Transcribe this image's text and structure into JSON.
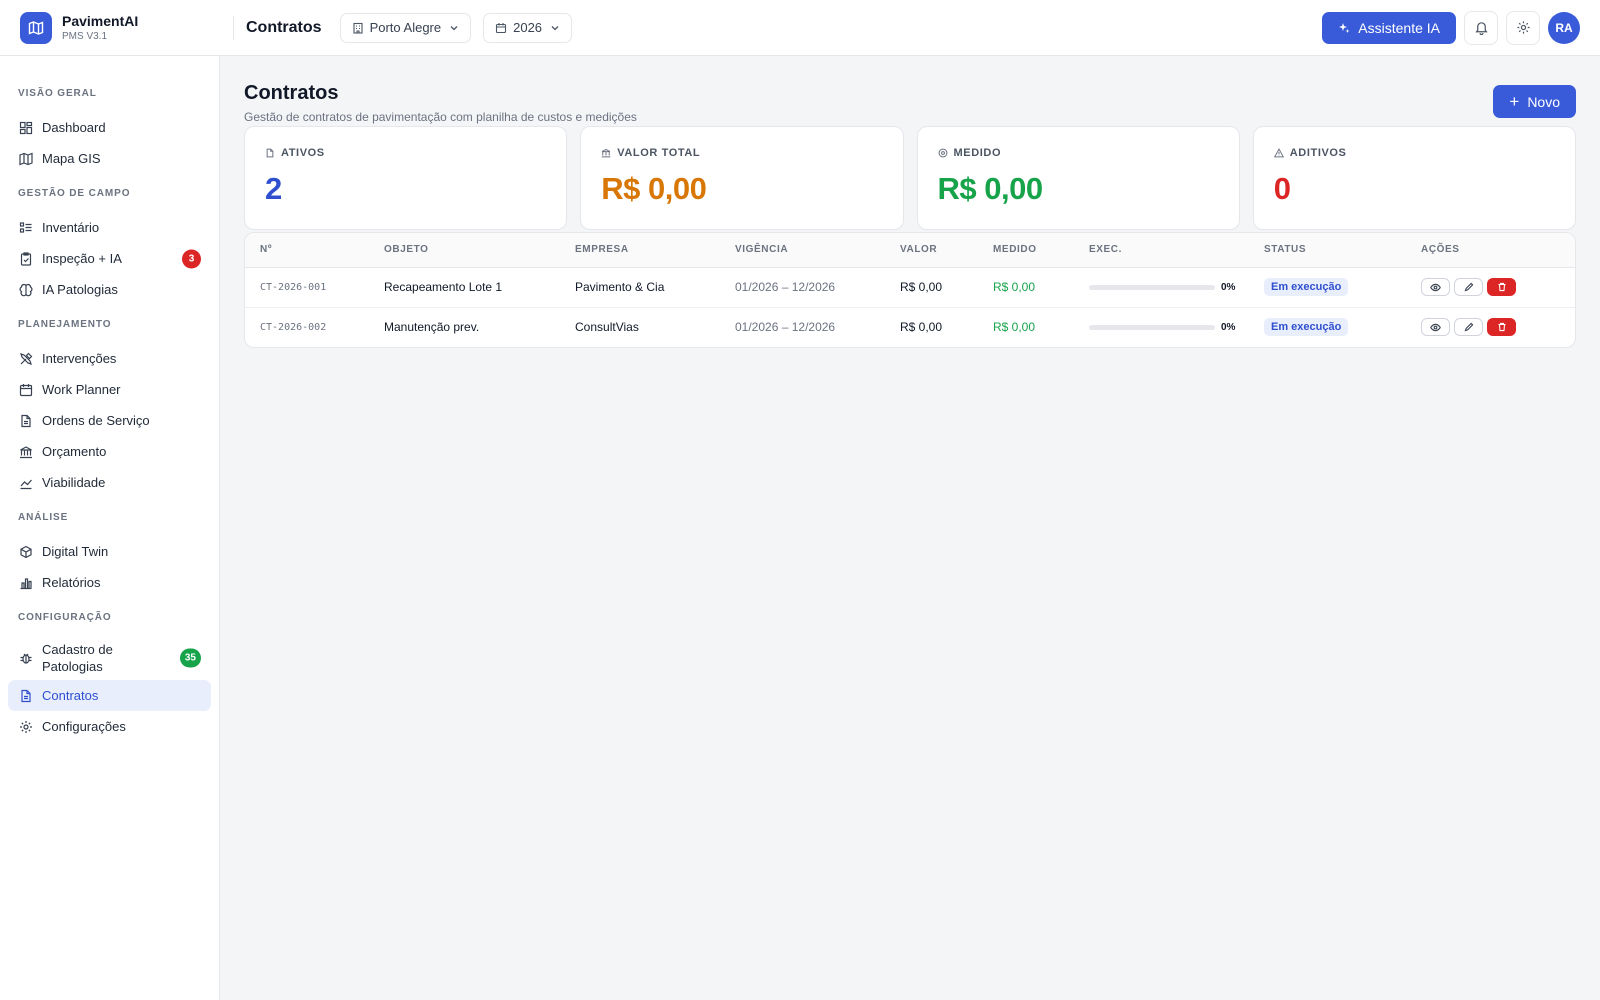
{
  "brand": {
    "name": "PavimentAI",
    "version": "PMS V3.1"
  },
  "topbar": {
    "title": "Contratos",
    "city": "Porto Alegre",
    "year": "2026",
    "ai_button": "Assistente IA",
    "avatar": "RA"
  },
  "sidebar": {
    "sections": [
      {
        "title": "VISÃO GERAL",
        "items": [
          {
            "label": "Dashboard",
            "icon": "dashboard-icon"
          },
          {
            "label": "Mapa GIS",
            "icon": "map-icon"
          }
        ]
      },
      {
        "title": "GESTÃO DE CAMPO",
        "items": [
          {
            "label": "Inventário",
            "icon": "list-icon"
          },
          {
            "label": "Inspeção + IA",
            "icon": "clipboard-icon",
            "badge": "3",
            "badge_color": "#dc2626"
          },
          {
            "label": "IA Patologias",
            "icon": "brain-icon"
          }
        ]
      },
      {
        "title": "PLANEJAMENTO",
        "items": [
          {
            "label": "Intervenções",
            "icon": "tools-icon"
          },
          {
            "label": "Work Planner",
            "icon": "calendar-icon"
          },
          {
            "label": "Ordens de Serviço",
            "icon": "file-icon"
          },
          {
            "label": "Orçamento",
            "icon": "bank-icon"
          },
          {
            "label": "Viabilidade",
            "icon": "trend-icon"
          }
        ]
      },
      {
        "title": "ANÁLISE",
        "items": [
          {
            "label": "Digital Twin",
            "icon": "cube-icon"
          },
          {
            "label": "Relatórios",
            "icon": "bar-chart-icon"
          }
        ]
      },
      {
        "title": "CONFIGURAÇÃO",
        "items": [
          {
            "label": "Cadastro de Patologias",
            "icon": "bug-icon",
            "badge": "35",
            "badge_color": "#16a34a"
          },
          {
            "label": "Contratos",
            "icon": "contract-icon",
            "active": true
          },
          {
            "label": "Configurações",
            "icon": "gear-icon"
          }
        ]
      }
    ]
  },
  "page": {
    "title": "Contratos",
    "subtitle": "Gestão de contratos de pavimentação com planilha de custos e medições",
    "new_button": "Novo"
  },
  "cards": [
    {
      "label": "ATIVOS",
      "value": "2",
      "color": "#2f4fcf",
      "icon": "file-icon"
    },
    {
      "label": "VALOR TOTAL",
      "value": "R$ 0,00",
      "color": "#d97706",
      "icon": "bank-icon"
    },
    {
      "label": "MEDIDO",
      "value": "R$ 0,00",
      "color": "#16a34a",
      "icon": "target-icon"
    },
    {
      "label": "ADITIVOS",
      "value": "0",
      "color": "#dc2626",
      "icon": "warning-icon"
    }
  ],
  "table": {
    "columns": [
      "Nº",
      "OBJETO",
      "EMPRESA",
      "VIGÊNCIA",
      "VALOR",
      "MEDIDO",
      "EXEC.",
      "STATUS",
      "AÇÕES"
    ],
    "rows": [
      {
        "numero": "CT-2026-001",
        "objeto": "Recapeamento Lote 1",
        "empresa": "Pavimento & Cia",
        "vigencia": "01/2026 – 12/2026",
        "valor": "R$ 0,00",
        "medido": "R$ 0,00",
        "exec": "0%",
        "exec_fraction": 0,
        "status": "Em execução"
      },
      {
        "numero": "CT-2026-002",
        "objeto": "Manutenção prev.",
        "empresa": "ConsultVias",
        "vigencia": "01/2026 – 12/2026",
        "valor": "R$ 0,00",
        "medido": "R$ 0,00",
        "exec": "0%",
        "exec_fraction": 0,
        "status": "Em execução"
      }
    ]
  }
}
